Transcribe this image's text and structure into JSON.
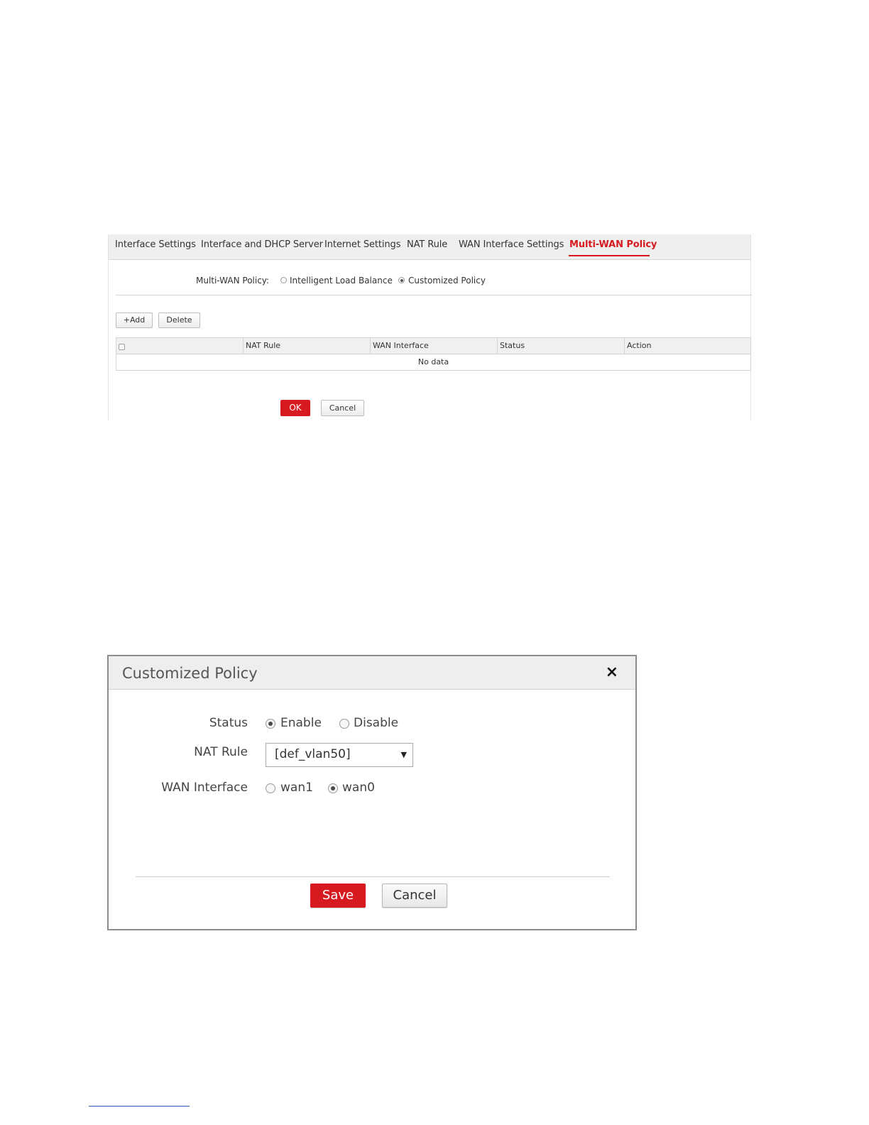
{
  "page": {
    "tabs": [
      {
        "label": "Interface Settings",
        "active": false
      },
      {
        "label": "Interface and DHCP Server",
        "active": false
      },
      {
        "label": "Internet Settings",
        "active": false
      },
      {
        "label": "NAT Rule",
        "active": false
      },
      {
        "label": "WAN Interface Settings",
        "active": false
      },
      {
        "label": "Multi-WAN Policy",
        "active": true
      }
    ],
    "policy": {
      "label": "Multi-WAN Policy:",
      "options": [
        {
          "label": "Intelligent Load Balance",
          "checked": false
        },
        {
          "label": "Customized Policy",
          "checked": true
        }
      ]
    },
    "toolbar": {
      "add_label": "+Add",
      "delete_label": "Delete"
    },
    "table": {
      "columns": [
        "NAT Rule",
        "WAN Interface",
        "Status",
        "Action"
      ],
      "empty_text": "No data"
    },
    "actions": {
      "ok_label": "OK",
      "cancel_label": "Cancel"
    }
  },
  "dialog": {
    "title": "Customized Policy",
    "close_glyph": "×",
    "status": {
      "label": "Status",
      "options": [
        {
          "label": "Enable",
          "checked": true
        },
        {
          "label": "Disable",
          "checked": false
        }
      ]
    },
    "nat_rule": {
      "label": "NAT Rule",
      "value": "[def_vlan50]"
    },
    "wan_interface": {
      "label": "WAN Interface",
      "options": [
        {
          "label": "wan1",
          "checked": false
        },
        {
          "label": "wan0",
          "checked": true
        }
      ]
    },
    "save_label": "Save",
    "cancel_label": "Cancel"
  },
  "colors": {
    "accent": "#d71920",
    "tab_bar": "#efefef",
    "dialog_header": "#eeeeee"
  }
}
